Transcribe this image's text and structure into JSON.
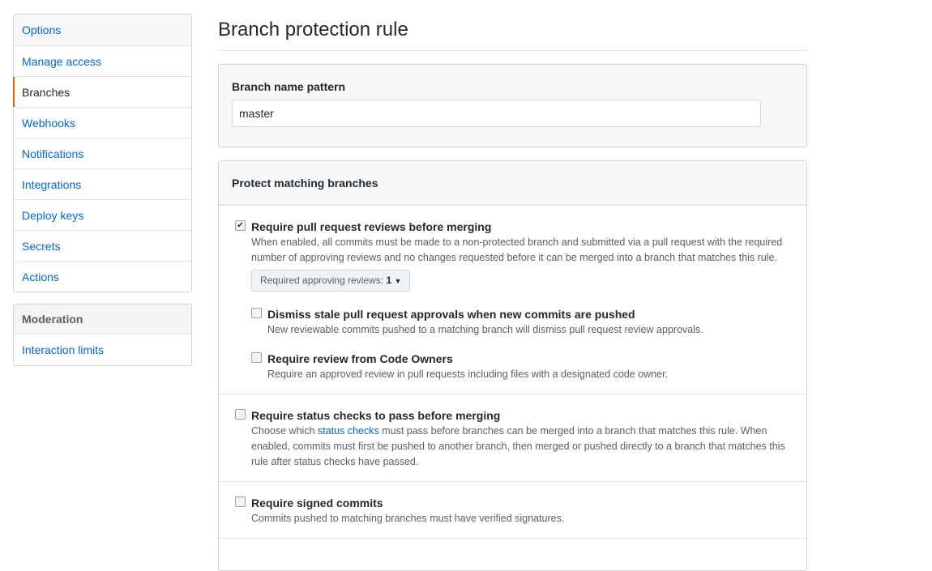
{
  "sidebar": {
    "items": [
      {
        "label": "Options"
      },
      {
        "label": "Manage access"
      },
      {
        "label": "Branches"
      },
      {
        "label": "Webhooks"
      },
      {
        "label": "Notifications"
      },
      {
        "label": "Integrations"
      },
      {
        "label": "Deploy keys"
      },
      {
        "label": "Secrets"
      },
      {
        "label": "Actions"
      }
    ],
    "selected": "Branches",
    "moderation": {
      "heading": "Moderation",
      "items": [
        {
          "label": "Interaction limits"
        }
      ]
    }
  },
  "main": {
    "title": "Branch protection rule",
    "pattern": {
      "label": "Branch name pattern",
      "value": "master"
    },
    "protect": {
      "heading": "Protect matching branches",
      "pr_reviews": {
        "checked": true,
        "title": "Require pull request reviews before merging",
        "desc": "When enabled, all commits must be made to a non-protected branch and submitted via a pull request with the required number of approving reviews and no changes requested before it can be merged into a branch that matches this rule.",
        "select_label": "Required approving reviews:",
        "select_value": "1",
        "dismiss": {
          "checked": false,
          "title": "Dismiss stale pull request approvals when new commits are pushed",
          "desc": "New reviewable commits pushed to a matching branch will dismiss pull request review approvals."
        },
        "codeowners": {
          "checked": false,
          "title": "Require review from Code Owners",
          "desc": "Require an approved review in pull requests including files with a designated code owner."
        }
      },
      "status": {
        "checked": false,
        "title": "Require status checks to pass before merging",
        "desc_pre": "Choose which ",
        "desc_link": "status checks",
        "desc_post": " must pass before branches can be merged into a branch that matches this rule. When enabled, commits must first be pushed to another branch, then merged or pushed directly to a branch that matches this rule after status checks have passed."
      },
      "signed": {
        "checked": false,
        "title": "Require signed commits",
        "desc": "Commits pushed to matching branches must have verified signatures."
      }
    }
  },
  "colors": {
    "link": "#0366d6",
    "selected_marker": "#e36209"
  }
}
